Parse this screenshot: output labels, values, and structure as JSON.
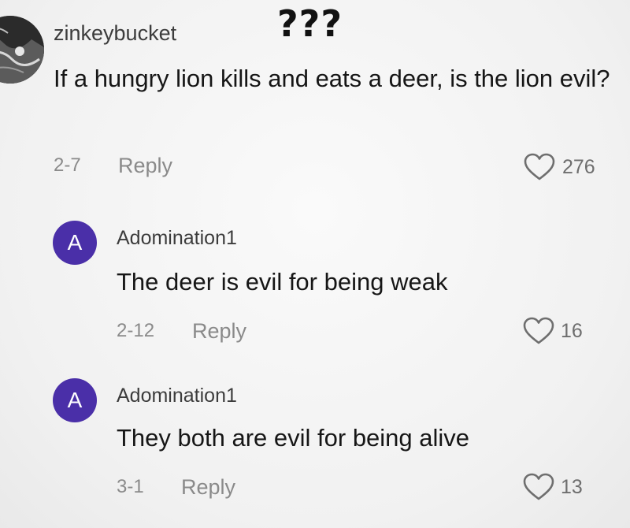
{
  "overlay": {
    "title": "???"
  },
  "main_comment": {
    "username": "zinkeybucket",
    "text": "If a hungry lion kills and eats a deer, is the lion evil?",
    "date": "2-7",
    "reply_label": "Reply",
    "likes": "276",
    "like_icon": "heart-outline-icon",
    "avatar_icon": "profile-photo"
  },
  "replies": [
    {
      "avatar_letter": "A",
      "username": "Adomination1",
      "text": "The deer is evil for being weak",
      "date": "2-12",
      "reply_label": "Reply",
      "likes": "16",
      "like_icon": "heart-outline-icon"
    },
    {
      "avatar_letter": "A",
      "username": "Adomination1",
      "text": "They both are evil for being alive",
      "date": "3-1",
      "reply_label": "Reply",
      "likes": "13",
      "like_icon": "heart-outline-icon"
    }
  ],
  "colors": {
    "avatar_purple": "#4a2fa8",
    "meta_gray": "#8a8a8a",
    "text": "#161616"
  }
}
